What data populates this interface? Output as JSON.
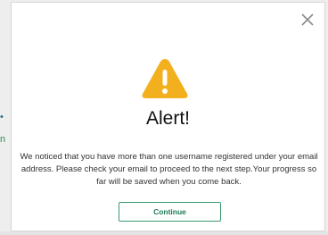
{
  "background": {
    "marks": [
      "•",
      "n"
    ]
  },
  "modal": {
    "title": "Alert!",
    "message": "We noticed that you have more than one username registered under your email address. Please check your email to proceed to the next step.Your progress so far will be saved when you come back.",
    "continue_label": "Continue",
    "close_icon": "close-icon",
    "alert_icon": "warning-triangle-icon",
    "colors": {
      "warning": "#f2b01e",
      "button_border": "#3a9a6e",
      "button_text": "#1f7a55"
    }
  }
}
